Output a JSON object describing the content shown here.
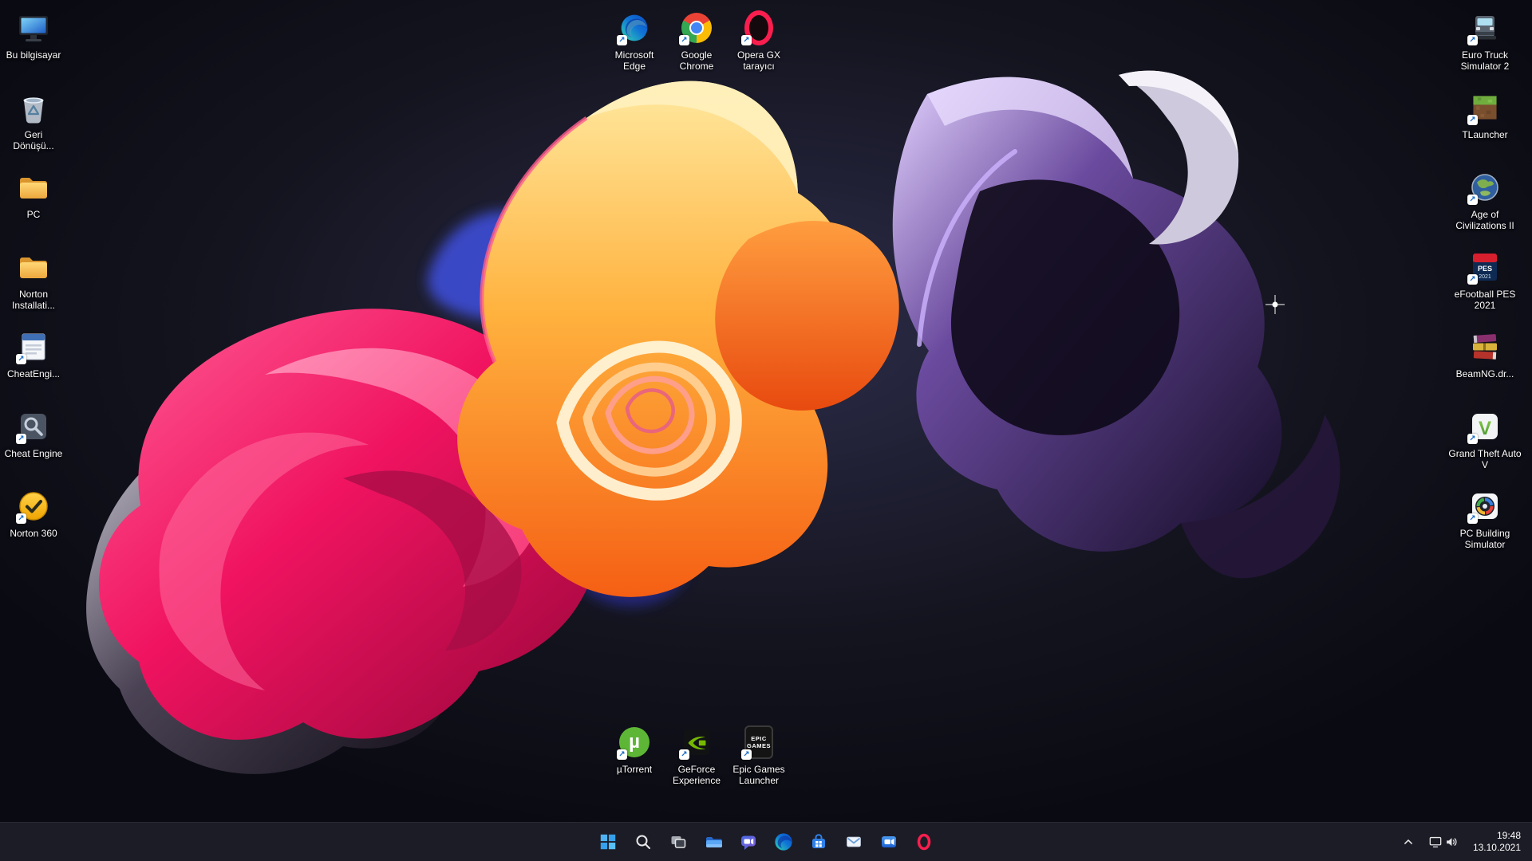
{
  "desktop": {
    "left_icons": [
      {
        "label": "Bu bilgisayar",
        "icon": "this-pc-icon"
      },
      {
        "label": "Geri\nDönüşü...",
        "icon": "recycle-bin-icon"
      },
      {
        "label": "PC",
        "icon": "folder-icon"
      },
      {
        "label": "Norton Installati...",
        "icon": "folder-icon"
      },
      {
        "label": "CheatEngi...",
        "icon": "installer-file-icon"
      },
      {
        "label": "Cheat Engine",
        "icon": "cheat-engine-icon"
      },
      {
        "label": "Norton 360",
        "icon": "norton-360-icon"
      }
    ],
    "top_icons": [
      {
        "label": "Microsoft Edge",
        "icon": "edge-icon"
      },
      {
        "label": "Google Chrome",
        "icon": "chrome-icon"
      },
      {
        "label": "Opera GX tarayıcı",
        "icon": "opera-gx-icon"
      }
    ],
    "right_icons": [
      {
        "label": "Euro Truck Simulator 2",
        "icon": "truck-icon"
      },
      {
        "label": "TLauncher",
        "icon": "grass-block-icon"
      },
      {
        "label": "Age of Civilizations II",
        "icon": "globe-map-icon"
      },
      {
        "label": "eFootball PES 2021",
        "icon": "pes-card-icon"
      },
      {
        "label": "BeamNG.dr...",
        "icon": "archive-books-icon"
      },
      {
        "label": "Grand Theft Auto V",
        "icon": "gta-v-icon"
      },
      {
        "label": "PC Building Simulator",
        "icon": "pc-fan-icon"
      }
    ],
    "bottom_icons": [
      {
        "label": "µTorrent",
        "icon": "utorrent-icon"
      },
      {
        "label": "GeForce Experience",
        "icon": "geforce-icon"
      },
      {
        "label": "Epic Games Launcher",
        "icon": "epic-games-icon"
      }
    ],
    "icon_art": {
      "shortcut_arrow": "↗",
      "gta_letter": "V",
      "epic_line1": "EPIC",
      "epic_line2": "GAMES",
      "pes_line1": "PES",
      "pes_line2": "2021",
      "utorrent_glyph": "µ"
    }
  },
  "taskbar": {
    "buttons": [
      "start",
      "search",
      "task-view",
      "file-explorer",
      "chat",
      "edge",
      "microsoft-store",
      "mail",
      "movies-tv",
      "opera-gx"
    ],
    "tray": {
      "time": "19:48",
      "date": "13.10.2021"
    }
  },
  "colors": {
    "taskbar_bg": "#1e1e28",
    "accent_blue": "#4fb2f2",
    "opera_red": "#fa1e4e",
    "nvidia_green": "#76b900",
    "utorrent_green": "#5eb636"
  }
}
